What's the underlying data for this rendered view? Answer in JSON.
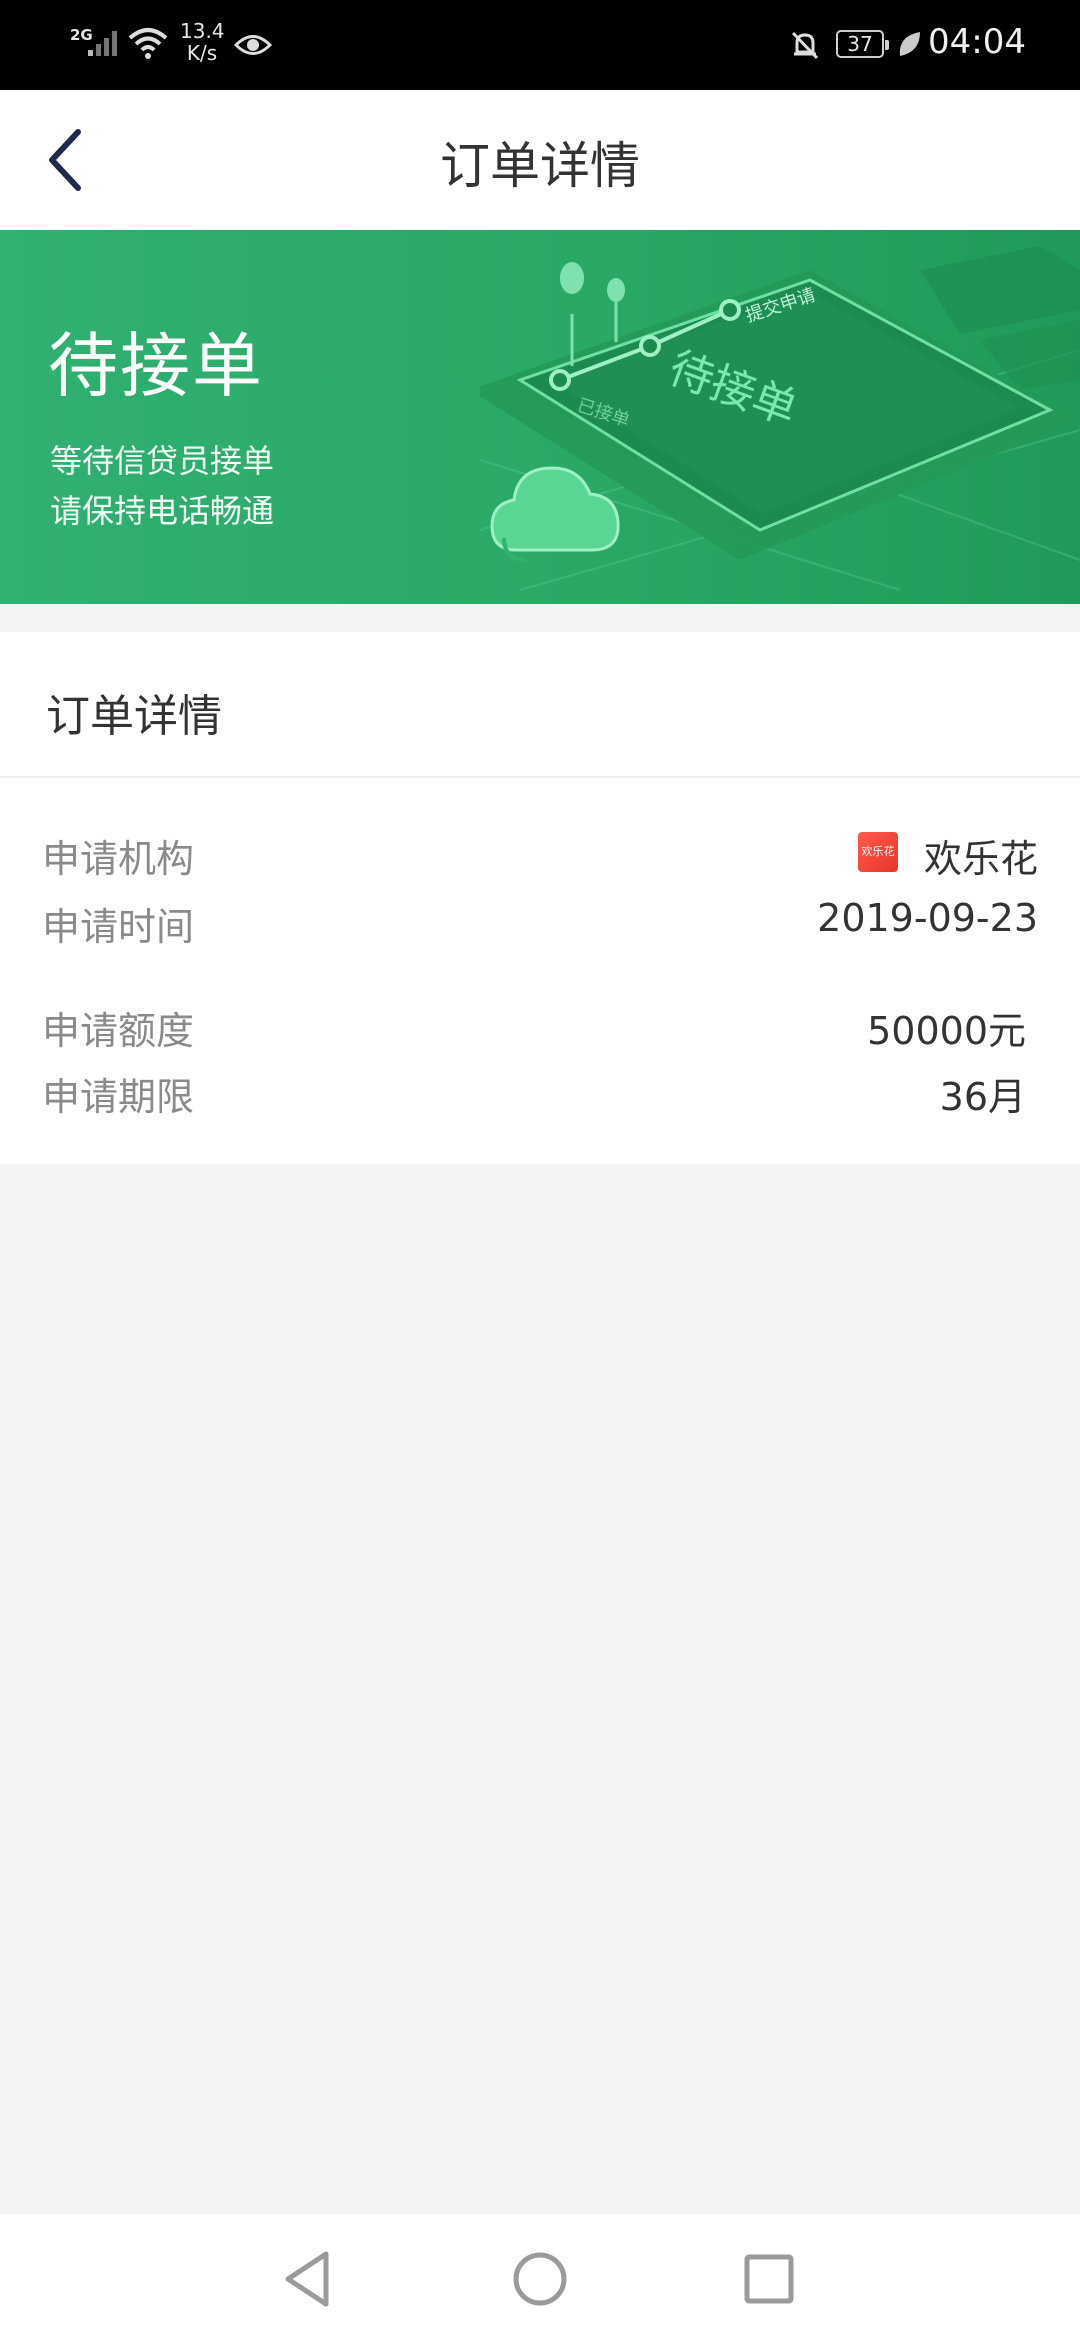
{
  "status_bar": {
    "network": "2G",
    "speed_value": "13.4",
    "speed_unit": "K/s",
    "battery": "37",
    "time": "04:04"
  },
  "header": {
    "title": "订单详情",
    "back_icon": "chevron-left-icon"
  },
  "banner": {
    "status_title": "待接单",
    "line1": "等待信贷员接单",
    "line2": "请保持电话畅通",
    "art_text_main": "待接单",
    "art_text_top": "提交申请",
    "art_text_bottom": "已接单",
    "colors": {
      "green": "#2aa866"
    }
  },
  "details": {
    "section_title": "订单详情",
    "rows": [
      {
        "label": "申请机构",
        "value": "欢乐花",
        "logo_text": "欢乐花"
      },
      {
        "label": "申请时间",
        "value": "2019-09-23"
      },
      {
        "label": "申请额度",
        "value": "50000元"
      },
      {
        "label": "申请期限",
        "value": "36月"
      }
    ]
  },
  "nav_bar": {
    "back_icon": "triangle-back-icon",
    "home_icon": "circle-home-icon",
    "recent_icon": "square-recent-icon"
  }
}
